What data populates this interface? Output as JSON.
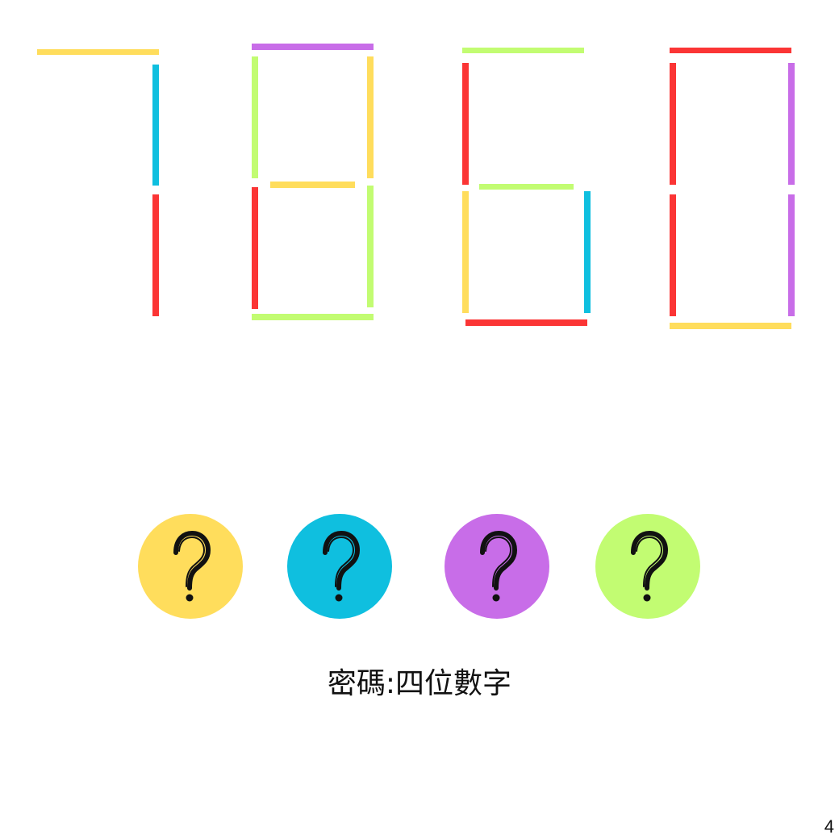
{
  "colors": {
    "yellow": "#FFDD5C",
    "cyan": "#0FBFDF",
    "red": "#FB3535",
    "purple": "#C86DE8",
    "lime": "#C2FC72"
  },
  "digits": [
    {
      "value": "7",
      "segments": [
        {
          "segment": "top",
          "color": "#FFDD5C"
        },
        {
          "segment": "upper-right",
          "color": "#0FBFDF"
        },
        {
          "segment": "lower-right",
          "color": "#FB3535"
        }
      ]
    },
    {
      "value": "8",
      "segments": [
        {
          "segment": "top",
          "color": "#C86DE8"
        },
        {
          "segment": "upper-left",
          "color": "#C2FC72"
        },
        {
          "segment": "upper-right",
          "color": "#FFDD5C"
        },
        {
          "segment": "middle",
          "color": "#FFDD5C"
        },
        {
          "segment": "lower-left",
          "color": "#FB3535"
        },
        {
          "segment": "lower-right",
          "color": "#C2FC72"
        },
        {
          "segment": "bottom",
          "color": "#C2FC72"
        }
      ]
    },
    {
      "value": "6",
      "segments": [
        {
          "segment": "top",
          "color": "#C2FC72"
        },
        {
          "segment": "upper-left",
          "color": "#FB3535"
        },
        {
          "segment": "middle",
          "color": "#C2FC72"
        },
        {
          "segment": "lower-left",
          "color": "#FFDD5C"
        },
        {
          "segment": "lower-right",
          "color": "#0FBFDF"
        },
        {
          "segment": "bottom",
          "color": "#FB3535"
        }
      ]
    },
    {
      "value": "0",
      "segments": [
        {
          "segment": "top",
          "color": "#FB3535"
        },
        {
          "segment": "upper-left",
          "color": "#FB3535"
        },
        {
          "segment": "upper-right",
          "color": "#C86DE8"
        },
        {
          "segment": "lower-left",
          "color": "#FB3535"
        },
        {
          "segment": "lower-right",
          "color": "#C86DE8"
        },
        {
          "segment": "bottom",
          "color": "#FFDD5C"
        }
      ]
    }
  ],
  "answer_slots": [
    {
      "color": "#FFDD5C",
      "symbol": "?"
    },
    {
      "color": "#0FBFDF",
      "symbol": "?"
    },
    {
      "color": "#C86DE8",
      "symbol": "?"
    },
    {
      "color": "#C2FC72",
      "symbol": "?"
    }
  ],
  "hint": {
    "text": "密碼:四位數字"
  },
  "page": {
    "number": "4"
  }
}
